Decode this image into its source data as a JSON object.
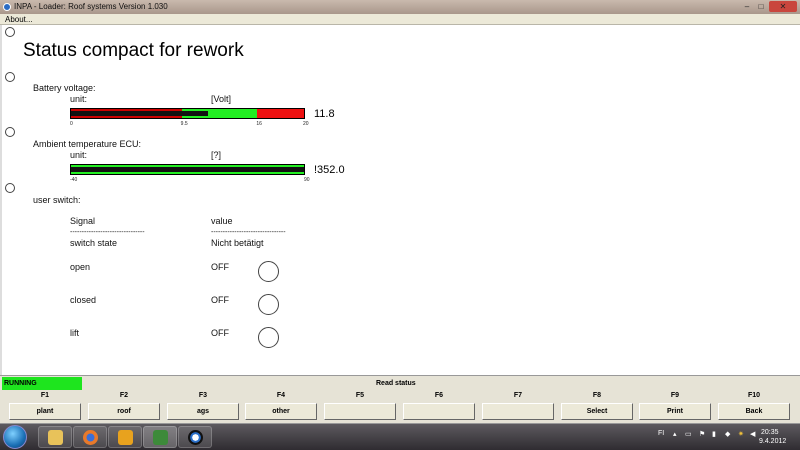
{
  "window": {
    "title": "INPA - Loader:  Roof systems Version 1.030",
    "minimize_icon": "minimize-icon",
    "maximize_icon": "maximize-icon",
    "close_icon": "close-icon",
    "minimize_glyph": "–",
    "maximize_glyph": "□",
    "close_glyph": "✕"
  },
  "menu": {
    "about": "About..."
  },
  "page": {
    "title": "Status compact for rework"
  },
  "battery": {
    "label": "Battery voltage:",
    "unit_label": "unit:",
    "unit": "[Volt]",
    "value": "11.8",
    "ticks": [
      "0",
      "9.5",
      "16",
      "20"
    ],
    "scale_min": 0,
    "scale_max": 20,
    "reading": 11.8,
    "zones": [
      {
        "from": 0,
        "to": 9.5,
        "color": "#cc0000"
      },
      {
        "from": 9.5,
        "to": 16,
        "color": "#22ee22"
      },
      {
        "from": 16,
        "to": 20,
        "color": "#ee1111"
      }
    ]
  },
  "ambient": {
    "label": "Ambient temperature ECU:",
    "unit_label": "unit:",
    "unit": "[?]",
    "value": "!352.0",
    "ticks": [
      "-40",
      "90"
    ],
    "fill_fraction": 1.0,
    "zone_color": "#22ee22"
  },
  "user_switch": {
    "label": "user switch:",
    "col_signal": "Signal",
    "col_value": "value",
    "divider": "--------------------------------",
    "rows": [
      {
        "signal": "switch state",
        "value": "Nicht betätigt"
      },
      {
        "signal": "open",
        "value": "OFF"
      },
      {
        "signal": "closed",
        "value": "OFF"
      },
      {
        "signal": "lift",
        "value": "OFF"
      }
    ]
  },
  "status": {
    "running": "RUNNING",
    "running_color": "#1ee51e",
    "center": "Read status"
  },
  "fkeys": [
    {
      "key": "F1",
      "label": "plant"
    },
    {
      "key": "F2",
      "label": "roof"
    },
    {
      "key": "F3",
      "label": "ags"
    },
    {
      "key": "F4",
      "label": "other"
    },
    {
      "key": "F5",
      "label": ""
    },
    {
      "key": "F6",
      "label": ""
    },
    {
      "key": "F7",
      "label": ""
    },
    {
      "key": "F8",
      "label": "Select"
    },
    {
      "key": "F9",
      "label": "Print"
    },
    {
      "key": "F10",
      "label": "Back"
    }
  ],
  "taskbar": {
    "apps": [
      "folder-icon",
      "firefox-icon",
      "outlook-icon",
      "excel-icon",
      "bmw-icon"
    ],
    "tray_lang": "FI",
    "time": "20:35",
    "date": "9.4.2012"
  }
}
